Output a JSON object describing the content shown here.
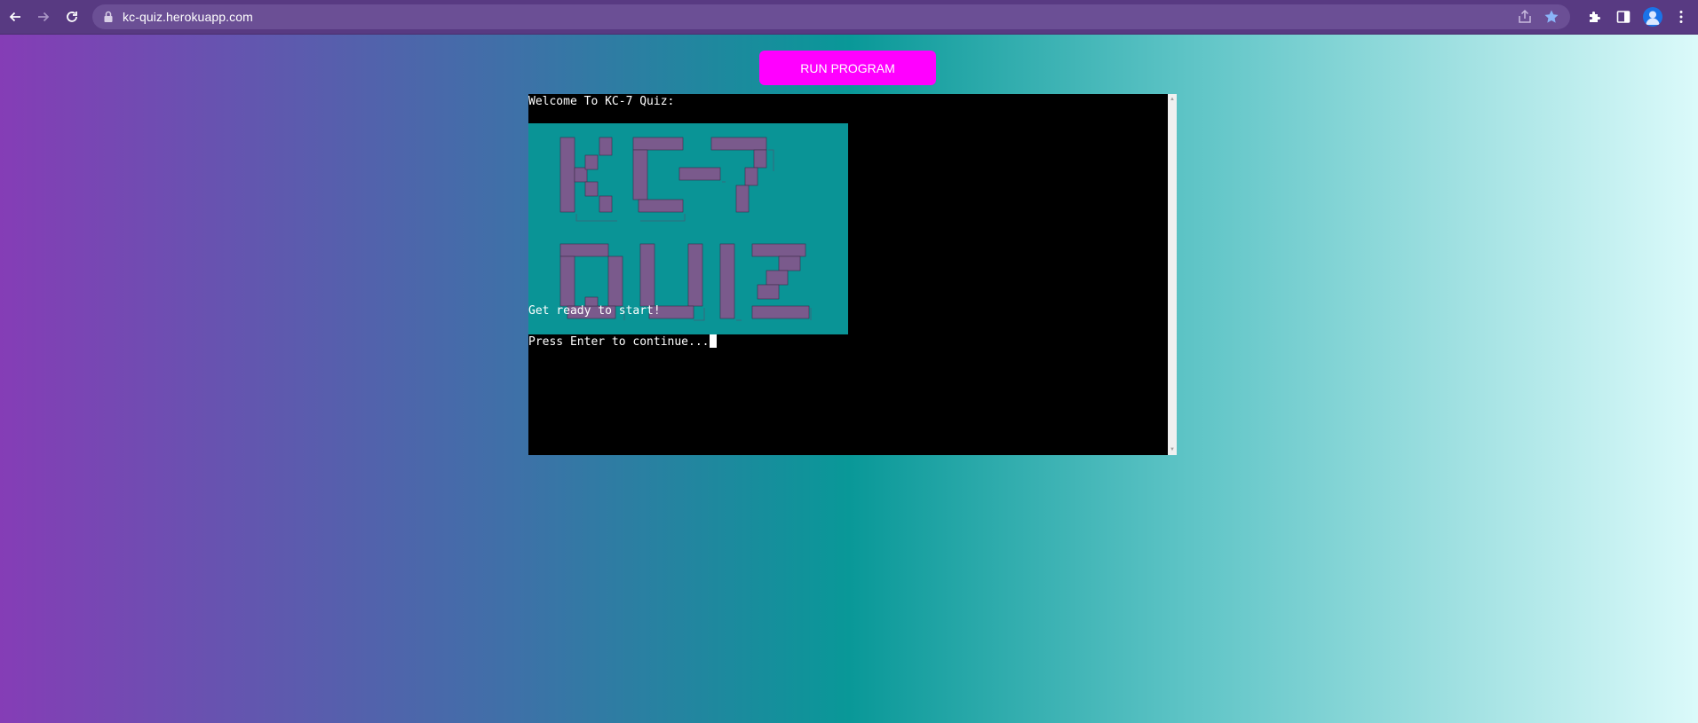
{
  "browser": {
    "url": "kc-quiz.herokuapp.com",
    "icons": {
      "back": "arrow-left-icon",
      "forward": "arrow-right-icon",
      "reload": "reload-icon",
      "lock": "lock-icon",
      "share": "share-icon",
      "bookmark": "star-icon",
      "extensions": "puzzle-icon",
      "side_panel": "side-panel-icon",
      "profile": "profile-avatar-icon",
      "menu": "kebab-menu-icon"
    },
    "colors": {
      "toolbar": "#583a82",
      "bookmark_star": "#8ab4f8"
    }
  },
  "page": {
    "run_button_label": "RUN PROGRAM",
    "colors": {
      "run_button": "#ff00ff",
      "gradient": [
        "#853db6",
        "#3f70a8",
        "#099898",
        "#5ec4c6",
        "#dbfafa"
      ],
      "logo_background": "#0a9496",
      "logo_text": "#7a5a8c"
    }
  },
  "terminal": {
    "welcome": "Welcome To KC-7 Quiz:",
    "logo_lines": [
      "KC-7",
      "QUIZ"
    ],
    "ready": "Get ready to start!",
    "prompt": "Press Enter to continue..."
  }
}
